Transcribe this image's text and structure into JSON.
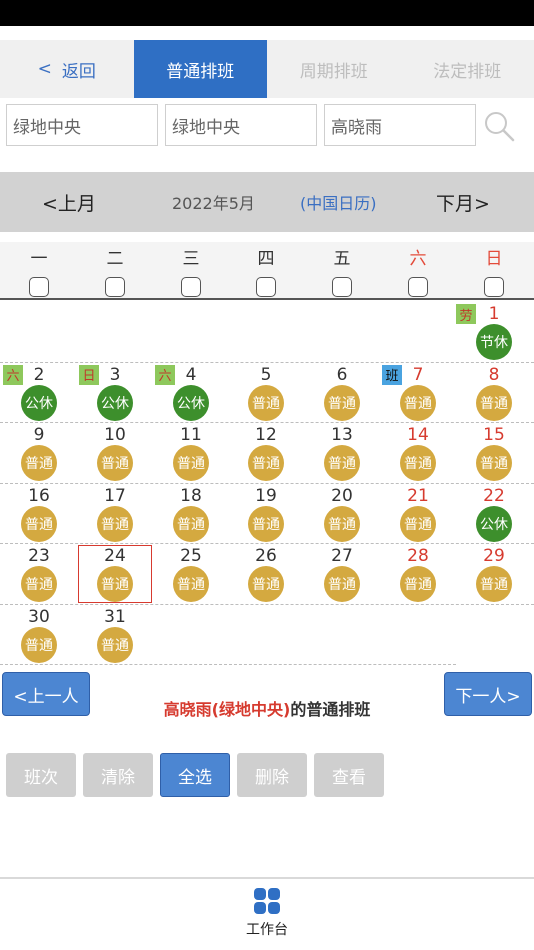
{
  "tabs": {
    "back_label": "返回",
    "items": [
      "普通排班",
      "周期排班",
      "法定排班"
    ]
  },
  "filters": {
    "project": "绿地中央",
    "site": "绿地中央",
    "person": "高晓雨"
  },
  "month_bar": {
    "prev": "<上月",
    "current": "2022年5月",
    "calendar_type": "(中国日历)",
    "next": "下月>"
  },
  "weekdays": [
    "一",
    "二",
    "三",
    "四",
    "五",
    "六",
    "日"
  ],
  "calendar": {
    "weeks": [
      [
        null,
        null,
        null,
        null,
        null,
        null,
        {
          "day": "1",
          "tag": "劳",
          "badge": "节休"
        }
      ],
      [
        {
          "day": "2",
          "tag": "六",
          "badge": "公休"
        },
        {
          "day": "3",
          "tag": "日",
          "badge": "公休"
        },
        {
          "day": "4",
          "tag": "六",
          "badge": "公休"
        },
        {
          "day": "5",
          "badge": "普通"
        },
        {
          "day": "6",
          "badge": "普通"
        },
        {
          "day": "7",
          "tag": "班",
          "badge": "普通"
        },
        {
          "day": "8",
          "badge": "普通"
        }
      ],
      [
        {
          "day": "9",
          "badge": "普通"
        },
        {
          "day": "10",
          "badge": "普通"
        },
        {
          "day": "11",
          "badge": "普通"
        },
        {
          "day": "12",
          "badge": "普通"
        },
        {
          "day": "13",
          "badge": "普通"
        },
        {
          "day": "14",
          "badge": "普通"
        },
        {
          "day": "15",
          "badge": "普通"
        }
      ],
      [
        {
          "day": "16",
          "badge": "普通"
        },
        {
          "day": "17",
          "badge": "普通"
        },
        {
          "day": "18",
          "badge": "普通"
        },
        {
          "day": "19",
          "badge": "普通"
        },
        {
          "day": "20",
          "badge": "普通"
        },
        {
          "day": "21",
          "badge": "普通"
        },
        {
          "day": "22",
          "badge": "公休"
        }
      ],
      [
        {
          "day": "23",
          "badge": "普通"
        },
        {
          "day": "24",
          "badge": "普通",
          "selected": true
        },
        {
          "day": "25",
          "badge": "普通"
        },
        {
          "day": "26",
          "badge": "普通"
        },
        {
          "day": "27",
          "badge": "普通"
        },
        {
          "day": "28",
          "badge": "普通"
        },
        {
          "day": "29",
          "badge": "普通"
        }
      ],
      [
        {
          "day": "30",
          "badge": "普通"
        },
        {
          "day": "31",
          "badge": "普通"
        },
        null,
        null,
        null,
        null,
        null
      ]
    ]
  },
  "colors": {
    "normal_badge": "#d4a940",
    "rest_badge": "#3d8f2c",
    "accent": "#2f6fc4",
    "weekend_red": "#d63b2f"
  },
  "person_nav": {
    "prev": "<上一人",
    "next": "下一人>",
    "name_part": "高晓雨(绿地中央)",
    "suffix": "的普通排班"
  },
  "actions": [
    "班次",
    "清除",
    "全选",
    "删除",
    "查看"
  ],
  "bottom_tab": {
    "label": "工作台",
    "icon": "grid-apps-icon"
  }
}
